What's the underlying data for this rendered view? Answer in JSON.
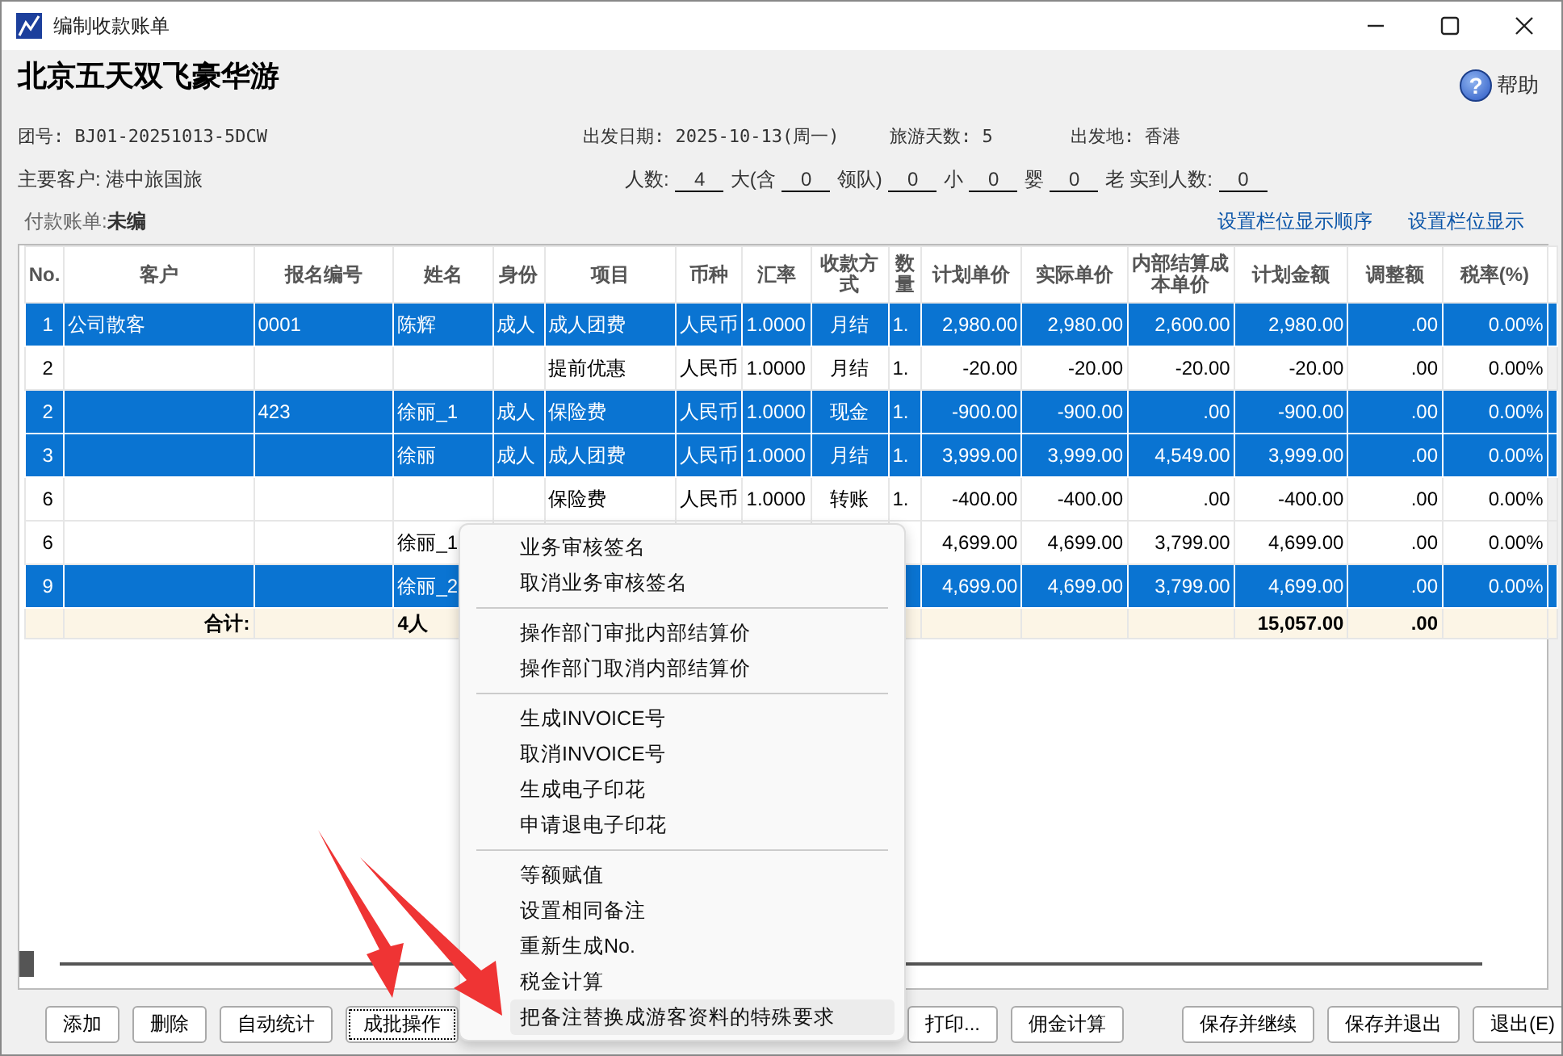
{
  "window": {
    "title": "编制收款账单"
  },
  "header": {
    "tour_name": "北京五天双飞豪华游",
    "help": {
      "icon": "?",
      "label": "帮助"
    },
    "group_no": "团号: BJ01-20251013-5DCW",
    "departure_date": "出发日期:  2025-10-13(周一)",
    "days": "旅游天数:  5",
    "origin": "出发地:  香港",
    "main_customer": "主要客户: 港中旅国旅",
    "people": [
      {
        "label": "人数:",
        "value": "4"
      },
      {
        "label": "大(含",
        "value": "0"
      },
      {
        "label": "领队)",
        "value": "0"
      },
      {
        "label": "小",
        "value": "0"
      },
      {
        "label": "婴",
        "value": "0"
      },
      {
        "label": "老   实到人数:",
        "value": "0"
      }
    ],
    "bill_label": "付款账单:",
    "bill_value": "未编",
    "links": [
      "设置栏位显示顺序",
      "设置栏位显示"
    ]
  },
  "table": {
    "columns": [
      "No.",
      "客户",
      "报名编号",
      "姓名",
      "身份",
      "项目",
      "币种",
      "汇率",
      "收款方式",
      "数量",
      "计划单价",
      "实际单价",
      "内部结算成本单价",
      "计划金额",
      "调整额",
      "税率(%)"
    ],
    "rows": [
      {
        "selected": true,
        "cells": [
          "1",
          "公司散客",
          "0001",
          "陈辉",
          "成人",
          "成人团费",
          "人民币",
          "1.0000",
          "月结",
          "1.",
          "2,980.00",
          "2,980.00",
          "2,600.00",
          "2,980.00",
          ".00",
          "0.00%"
        ]
      },
      {
        "selected": false,
        "cells": [
          "2",
          null,
          null,
          null,
          null,
          "提前优惠",
          "人民币",
          "1.0000",
          "月结",
          "1.",
          "-20.00",
          "-20.00",
          "-20.00",
          "-20.00",
          ".00",
          "0.00%"
        ]
      },
      {
        "selected": true,
        "cells": [
          "2",
          null,
          "423",
          "徐丽_1",
          "成人",
          "保险费",
          "人民币",
          "1.0000",
          "现金",
          "1.",
          "-900.00",
          "-900.00",
          ".00",
          "-900.00",
          ".00",
          "0.00%"
        ]
      },
      {
        "selected": true,
        "cells": [
          "3",
          null,
          null,
          "徐丽",
          "成人",
          "成人团费",
          "人民币",
          "1.0000",
          "月结",
          "1.",
          "3,999.00",
          "3,999.00",
          "4,549.00",
          "3,999.00",
          ".00",
          "0.00%"
        ]
      },
      {
        "selected": false,
        "cells": [
          "6",
          null,
          null,
          null,
          null,
          "保险费",
          "人民币",
          "1.0000",
          "转账",
          "1.",
          "-400.00",
          "-400.00",
          ".00",
          "-400.00",
          ".00",
          "0.00%"
        ]
      },
      {
        "selected": false,
        "cells": [
          "6",
          null,
          null,
          "徐丽_1",
          null,
          null,
          null,
          null,
          null,
          null,
          "4,699.00",
          "4,699.00",
          "3,799.00",
          "4,699.00",
          ".00",
          "0.00%"
        ]
      },
      {
        "selected": true,
        "cells": [
          "9",
          null,
          null,
          "徐丽_2",
          null,
          null,
          null,
          null,
          null,
          null,
          "4,699.00",
          "4,699.00",
          "3,799.00",
          "4,699.00",
          ".00",
          "0.00%"
        ]
      }
    ],
    "totals": {
      "label": "合计:",
      "people": "4人",
      "planned_total": "15,057.00",
      "adjustment_total": ".00"
    }
  },
  "menu": [
    [
      {
        "label": "业务审核签名",
        "selected": false
      },
      {
        "label": "取消业务审核签名",
        "selected": false
      }
    ],
    [
      {
        "label": "操作部门审批内部结算价",
        "selected": false
      },
      {
        "label": "操作部门取消内部结算价",
        "selected": false
      }
    ],
    [
      {
        "label": "生成INVOICE号",
        "selected": false
      },
      {
        "label": "取消INVOICE号",
        "selected": false
      },
      {
        "label": "生成电子印花",
        "selected": false
      },
      {
        "label": "申请退电子印花",
        "selected": false
      }
    ],
    [
      {
        "label": "等额赋值",
        "selected": false
      },
      {
        "label": "设置相同备注",
        "selected": false
      },
      {
        "label": "重新生成No.",
        "selected": false
      },
      {
        "label": "税金计算",
        "selected": false
      },
      {
        "label": "把备注替换成游客资料的特殊要求",
        "selected": true
      }
    ]
  ],
  "buttons_left": [
    "添加",
    "删除",
    "自动统计",
    "成批操作"
  ],
  "buttons_right": [
    "打印...",
    "佣金计算"
  ],
  "buttons_end": [
    "保存并继续",
    "保存并退出",
    "退出(E)"
  ]
}
